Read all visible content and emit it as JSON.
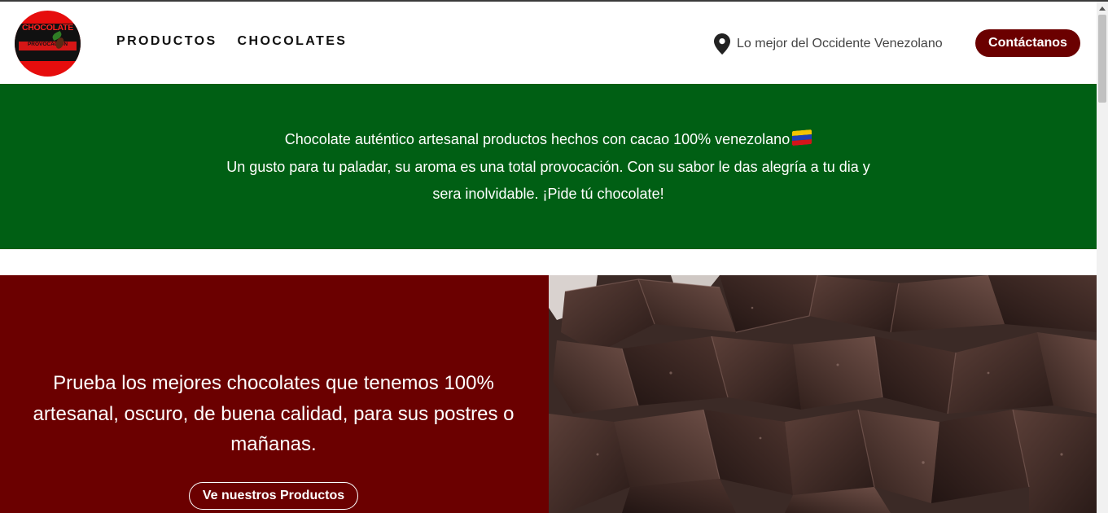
{
  "brand": {
    "logo_title": "CHOCOLATE",
    "logo_subtitle": "PROVOCACIÓN"
  },
  "nav": {
    "items": [
      {
        "label": "PRODUCTOS"
      },
      {
        "label": "CHOCOLATES"
      }
    ]
  },
  "header": {
    "location_icon": "map-pin-icon",
    "location_text": "Lo mejor del Occidente Venezolano",
    "contact_label": "Contáctanos"
  },
  "banner": {
    "line1": "Chocolate auténtico artesanal productos hechos con cacao 100% venezolano",
    "flag_icon": "venezuela-flag-icon",
    "line2": "Un gusto para tu paladar, su aroma es una total provocación. Con su sabor le das alegría a tu dia y sera inolvidable. ¡Pide tú chocolate!"
  },
  "feature": {
    "text": "Prueba los mejores chocolates que tenemos 100% artesanal, oscuro, de buena calidad, para sus postres o mañanas.",
    "button_label": "Ve nuestros Productos",
    "image_subject": "dark-chocolate-pieces"
  },
  "colors": {
    "accent_dark_red": "#6b0000",
    "banner_green": "#005f14",
    "logo_red": "#e60d0d"
  }
}
